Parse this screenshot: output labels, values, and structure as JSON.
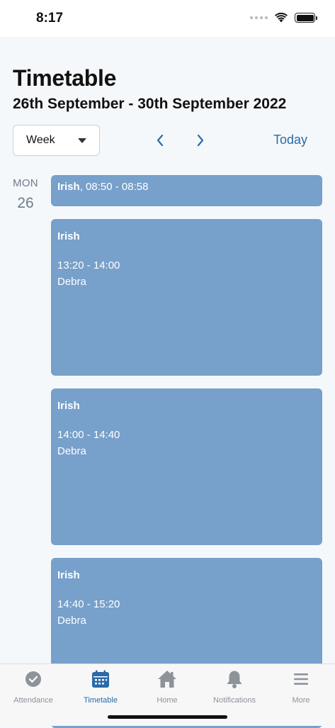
{
  "status_bar": {
    "time": "8:17"
  },
  "header": {
    "title": "Timetable",
    "date_range": "26th September - 30th September 2022"
  },
  "controls": {
    "view_selected": "Week",
    "today_label": "Today"
  },
  "day": {
    "name": "MON",
    "number": "26"
  },
  "events": [
    {
      "subject": "Irish",
      "time": ", 08:50 - 08:58"
    },
    {
      "subject": "Irish",
      "time": "13:20 - 14:00",
      "teacher": "Debra"
    },
    {
      "subject": "Irish",
      "time": "14:00 - 14:40",
      "teacher": "Debra"
    },
    {
      "subject": "Irish",
      "time": "14:40 - 15:20",
      "teacher": "Debra"
    }
  ],
  "tabs": [
    {
      "label": "Attendance",
      "icon": "check-circle-icon",
      "active": false
    },
    {
      "label": "Timetable",
      "icon": "calendar-icon",
      "active": true
    },
    {
      "label": "Home",
      "icon": "home-icon",
      "active": false
    },
    {
      "label": "Notifications",
      "icon": "bell-icon",
      "active": false
    },
    {
      "label": "More",
      "icon": "menu-icon",
      "active": false
    }
  ],
  "colors": {
    "accent": "#2a6aa8",
    "event_bg": "#77a0cb",
    "inactive_tab": "#8d9399"
  }
}
